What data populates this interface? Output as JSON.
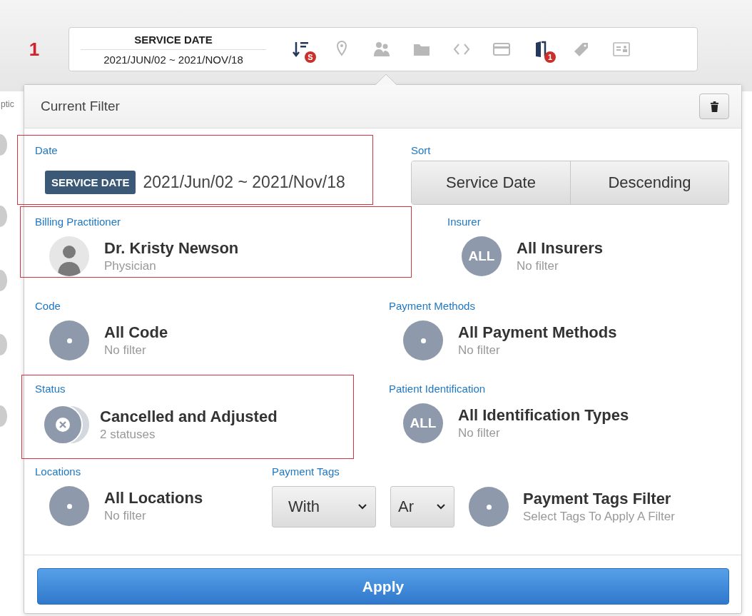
{
  "step_number": "1",
  "background_text": "ptic",
  "filter_bar": {
    "date_label": "SERVICE DATE",
    "date_range": "2021/JUN/02 ~ 2021/NOV/18",
    "icons": [
      {
        "kind": "sort",
        "active": true,
        "badge": "S"
      },
      {
        "kind": "pin",
        "active": false
      },
      {
        "kind": "people",
        "active": false
      },
      {
        "kind": "folder",
        "active": false
      },
      {
        "kind": "code",
        "active": false
      },
      {
        "kind": "card",
        "active": false
      },
      {
        "kind": "document",
        "active": true,
        "badge": "1"
      },
      {
        "kind": "tag",
        "active": false
      },
      {
        "kind": "id",
        "active": false
      }
    ]
  },
  "panel": {
    "title": "Current Filter",
    "date": {
      "label": "Date",
      "highlighted": true,
      "tag": "SERVICE DATE",
      "value": "2021/Jun/02 ~ 2021/Nov/18"
    },
    "sort": {
      "label": "Sort",
      "field": "Service Date",
      "order": "Descending"
    },
    "rows": [
      [
        {
          "label": "Billing Practitioner",
          "highlighted": true,
          "avatar": {
            "kind": "person"
          },
          "title": "Dr. Kristy Newson",
          "subtitle": "Physician"
        },
        {
          "label": "Insurer",
          "highlighted": false,
          "avatar": {
            "kind": "text",
            "text": "ALL"
          },
          "title": "All Insurers",
          "subtitle": "No filter"
        }
      ],
      [
        {
          "label": "Code",
          "highlighted": false,
          "avatar": {
            "kind": "dot"
          },
          "title": "All Code",
          "subtitle": "No filter"
        },
        {
          "label": "Payment Methods",
          "highlighted": false,
          "avatar": {
            "kind": "dot"
          },
          "title": "All Payment Methods",
          "subtitle": "No filter"
        }
      ],
      [
        {
          "label": "Status",
          "highlighted": true,
          "avatar": {
            "kind": "status"
          },
          "title": "Cancelled and Adjusted",
          "subtitle": "2 statuses"
        },
        {
          "label": "Patient Identification",
          "highlighted": false,
          "avatar": {
            "kind": "text",
            "text": "ALL"
          },
          "title": "All Identification Types",
          "subtitle": "No filter"
        }
      ],
      [
        {
          "label": "Locations",
          "highlighted": false,
          "avatar": {
            "kind": "dot"
          },
          "title": "All Locations",
          "subtitle": "No filter"
        },
        {
          "label": "Payment Tags",
          "highlighted": false,
          "avatar": {
            "kind": "dot"
          },
          "selects": [
            "With",
            "Ar"
          ],
          "title": "Payment Tags Filter",
          "subtitle": "Select Tags To Apply A Filter"
        }
      ]
    ],
    "apply": "Apply"
  }
}
